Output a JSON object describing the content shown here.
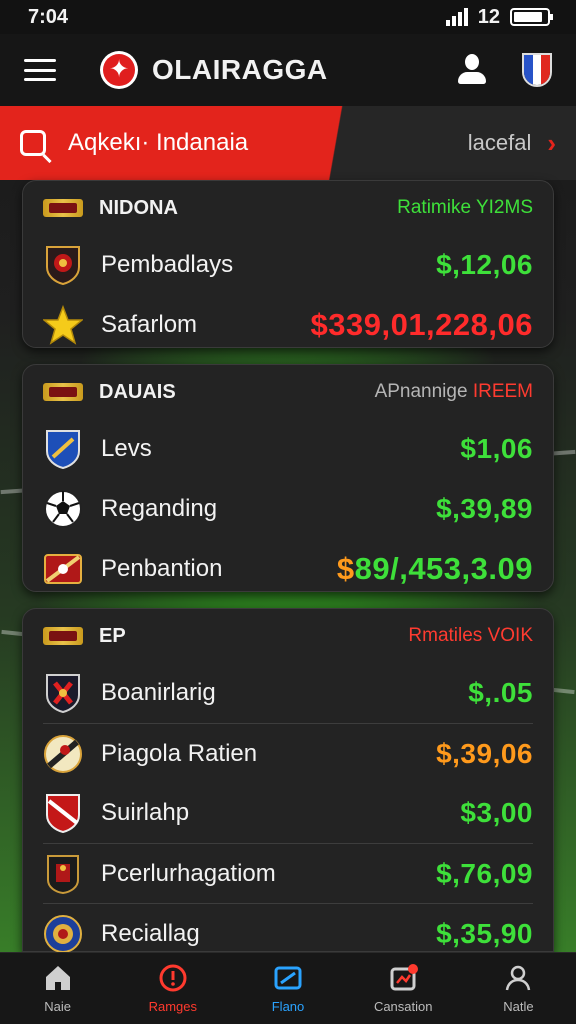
{
  "status_bar": {
    "time": "7:04",
    "battery_text": "12"
  },
  "header": {
    "title": "OLAIRAGGA"
  },
  "search": {
    "text": "Aqkekı· Indanaia",
    "link": "lacefal",
    "chevron": "›"
  },
  "cards": [
    {
      "league": "NIDONA",
      "status": "Ratimike YI2MS",
      "status_color": "#3ee03a",
      "rows": [
        {
          "icon": "club-crest-icon",
          "name": "Pembadlays",
          "amount": "$,12,06",
          "color": "green"
        },
        {
          "icon": "star-icon",
          "name": "Safarlom",
          "amount": "$339,01,228,06",
          "color": "red"
        }
      ]
    },
    {
      "league": "DAUAIS",
      "status_prefix": "APnannige",
      "status_suffix": "IREEM",
      "rows": [
        {
          "icon": "shield-crest-icon",
          "name": "Levs",
          "amount": "$1,06",
          "color": "green"
        },
        {
          "icon": "soccer-ball-icon",
          "name": "Reganding",
          "amount": "$,39,89",
          "color": "green"
        },
        {
          "icon": "banner-crest-icon",
          "name": "Penbantion",
          "amount_prefix": "$",
          "amount": "89/,453,3.09",
          "color": "green"
        }
      ]
    },
    {
      "league": "EP",
      "status": "Rmatiles VOIK",
      "status_color": "#ff3b30",
      "rows": [
        {
          "icon": "club-crest-icon",
          "name": "Boanirlarig",
          "amount": "$,.05",
          "color": "green"
        },
        {
          "icon": "striped-ball-icon",
          "name": "Piagola Ratien",
          "amount": "$,39,06",
          "color": "orange"
        },
        {
          "icon": "red-shield-icon",
          "name": "Suirlahp",
          "amount": "$3,00",
          "color": "green"
        },
        {
          "icon": "dark-crest-icon",
          "name": "Pcerlurhagatiom",
          "amount": "$,76,09",
          "color": "green"
        },
        {
          "icon": "blue-crest-icon",
          "name": "Reciallag",
          "amount": "$,35,90",
          "color": "green"
        }
      ]
    }
  ],
  "nav": [
    {
      "label": "Naie",
      "icon": "home-icon"
    },
    {
      "label": "Ramges",
      "icon": "alert-icon"
    },
    {
      "label": "Flano",
      "icon": "ticket-icon"
    },
    {
      "label": "Cansation",
      "icon": "notifications-icon"
    },
    {
      "label": "Natle",
      "icon": "profile-icon"
    }
  ],
  "colors": {
    "accent": "#e3241c",
    "up": "#3ee03a",
    "down": "#ff2b2b",
    "warn": "#ff9a1c",
    "blue": "#2aa3ff"
  }
}
